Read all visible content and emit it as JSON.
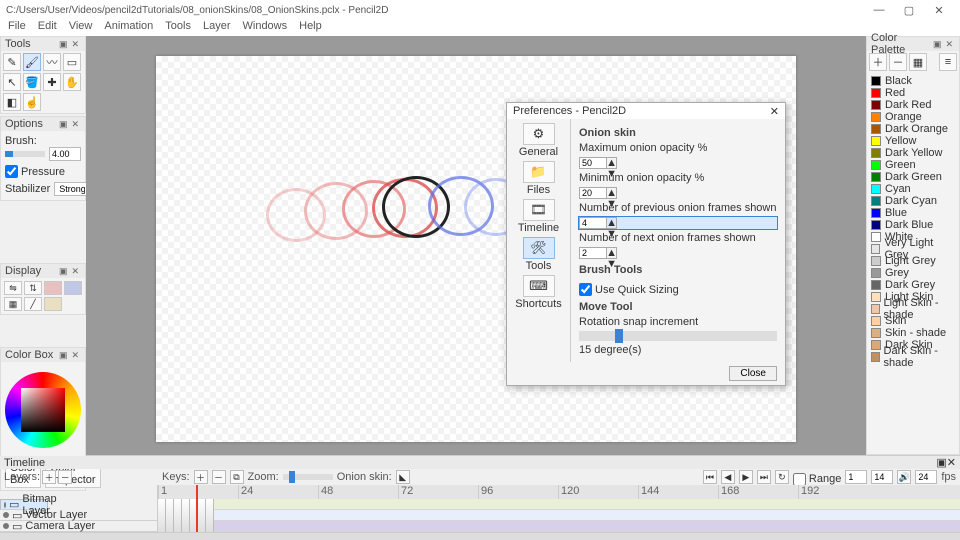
{
  "window": {
    "title": "C:/Users/User/Videos/pencil2dTutorials/08_onionSkins/08_OnionSkins.pclx - Pencil2D"
  },
  "menu": {
    "items": [
      "File",
      "Edit",
      "View",
      "Animation",
      "Tools",
      "Layer",
      "Windows",
      "Help"
    ]
  },
  "tools": {
    "title": "Tools"
  },
  "options": {
    "title": "Options",
    "brush_label": "Brush:",
    "brush_value": "4.00",
    "pressure_label": "Pressure",
    "stabilizer_label": "Stabilizer",
    "stabilizer_value": "Strong"
  },
  "display": {
    "title": "Display"
  },
  "colorbox": {
    "title": "Color Box",
    "tab1": "Color Box",
    "tab2": "Color Inspector"
  },
  "palette": {
    "title": "Color Palette",
    "swatches": [
      {
        "name": "Black",
        "hex": "#000000"
      },
      {
        "name": "Red",
        "hex": "#ff0000"
      },
      {
        "name": "Dark Red",
        "hex": "#800000"
      },
      {
        "name": "Orange",
        "hex": "#ff8000"
      },
      {
        "name": "Dark Orange",
        "hex": "#aa5500"
      },
      {
        "name": "Yellow",
        "hex": "#ffff00"
      },
      {
        "name": "Dark Yellow",
        "hex": "#808000"
      },
      {
        "name": "Green",
        "hex": "#00ff00"
      },
      {
        "name": "Dark Green",
        "hex": "#008000"
      },
      {
        "name": "Cyan",
        "hex": "#00ffff"
      },
      {
        "name": "Dark Cyan",
        "hex": "#008080"
      },
      {
        "name": "Blue",
        "hex": "#0000ff"
      },
      {
        "name": "Dark Blue",
        "hex": "#000080"
      },
      {
        "name": "White",
        "hex": "#ffffff"
      },
      {
        "name": "Very Light Grey",
        "hex": "#e6e6e6"
      },
      {
        "name": "Light Grey",
        "hex": "#cccccc"
      },
      {
        "name": "Grey",
        "hex": "#999999"
      },
      {
        "name": "Dark Grey",
        "hex": "#666666"
      },
      {
        "name": "Light Skin",
        "hex": "#ffe0c0"
      },
      {
        "name": "Light Skin - shade",
        "hex": "#eec8a8"
      },
      {
        "name": "Skin",
        "hex": "#ffd0a0"
      },
      {
        "name": "Skin - shade",
        "hex": "#dab082"
      },
      {
        "name": "Dark Skin",
        "hex": "#d8a878"
      },
      {
        "name": "Dark Skin - shade",
        "hex": "#c09060"
      }
    ]
  },
  "dialog": {
    "title": "Preferences - Pencil2D",
    "cats": [
      "General",
      "Files",
      "Timeline",
      "Tools",
      "Shortcuts"
    ],
    "onion_skin": "Onion skin",
    "max_opacity": "Maximum onion opacity %",
    "max_opacity_v": "50",
    "min_opacity": "Minimum onion opacity %",
    "min_opacity_v": "20",
    "prev_frames": "Number of previous onion frames shown",
    "prev_frames_v": "4",
    "next_frames": "Number of next onion frames shown",
    "next_frames_v": "2",
    "brush_tools": "Brush Tools",
    "quick_sizing": "Use Quick Sizing",
    "move_tool": "Move Tool",
    "rot_snap": "Rotation snap increment",
    "rot_val": "15 degree(s)",
    "close": "Close"
  },
  "timeline": {
    "title": "Timeline",
    "layers_label": "Layers:",
    "keys_label": "Keys:",
    "zoom_label": "Zoom:",
    "onion_label": "Onion skin:",
    "range_label": "Range",
    "range_a": "1",
    "range_b": "14",
    "fps_v": "24",
    "fps_l": "fps",
    "layers": [
      "Bitmap Layer",
      "Vector Layer",
      "Camera Layer"
    ],
    "ticks": [
      "1",
      "24",
      "48",
      "72",
      "96",
      "120",
      "144",
      "168",
      "192"
    ]
  }
}
